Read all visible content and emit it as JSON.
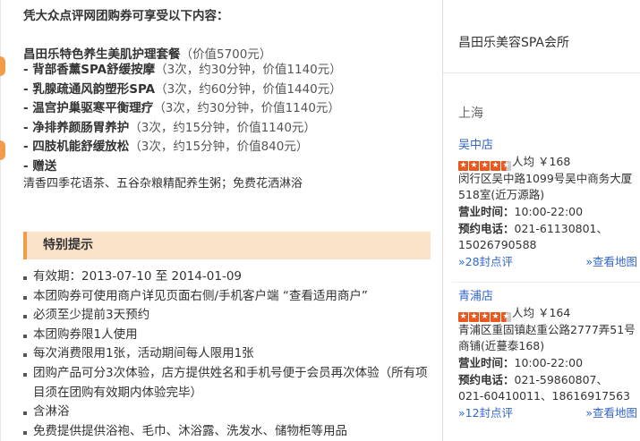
{
  "main": {
    "intro": "凭大众点评网团购券可享受以下内容：",
    "package": {
      "name": "昌田乐特色养生美肌护理套餐",
      "price": "（价值5700元）"
    },
    "items": [
      {
        "name": "- 背部香薰SPA舒缓按摩",
        "desc": "（3次，约30分钟，价值1140元）"
      },
      {
        "name": "- 乳腺疏通风韵塑形SPA",
        "desc": "（3次，约60分钟，价值1440元）"
      },
      {
        "name": "- 温宫护巢驱寒平衡理疗",
        "desc": "（3次，约30分钟，价值1140元）"
      },
      {
        "name": "- 净排养颜肠胃养护",
        "desc": "（3次，约15分钟，价值1140元）"
      },
      {
        "name": "- 四肢机能舒缓放松",
        "desc": "（3次，约15分钟，价值840元）"
      },
      {
        "name": "- 赠送",
        "desc": ""
      }
    ],
    "freebie": "清香四季花语茶、五谷杂粮精配养生粥；免费花洒淋浴",
    "notice_title": "特别提示",
    "tips": [
      "有效期：2013-07-10 至  2014-01-09",
      "本团购券可使用商户详见页面右侧/手机客户端 “查看适用商户”",
      "必须至少提前3天预约",
      "本团购券限1人使用",
      "每次消费限用1张，活动期间每人限用1张",
      "团购产品可分3次体验，店方提供姓名和手机号便于会员再次体验（所有项目须在团购有效期内体验完毕）",
      "含淋浴",
      "免费提供提供浴袍、毛巾、沐浴露、洗发水、储物柜等用品"
    ]
  },
  "sidebar": {
    "title": "昌田乐美容SPA会所",
    "city": "上海",
    "shops": [
      {
        "name": "吴中店",
        "rating": 4.5,
        "avg": "人均 ￥168",
        "address": "闵行区吴中路1099号吴中商务大厦518室(近万源路)",
        "hours_label": "营业时间：",
        "hours": "10:00-22:00",
        "phone_label": "预约电话：",
        "phone": "021-61130801、",
        "phone2": "15026790588",
        "reviews": "»28封点评",
        "map": "»查看地图"
      },
      {
        "name": "青浦店",
        "rating": 4.5,
        "avg": "人均 ￥164",
        "address": "青浦区重固镇赵重公路2777弄51号商铺(近蔓泰168)",
        "hours_label": "营业时间：",
        "hours": "10:00-22:00",
        "phone_label": "预约电话：",
        "phone": "021-59860807、",
        "phone2": "021-60410011、18616917563",
        "reviews": "»12封点评",
        "map": "»查看地图"
      }
    ]
  },
  "colors": {
    "accent": "#f29c4b",
    "notice_bg": "#fbe3c9",
    "link": "#3366cc",
    "star": "#e9581f"
  }
}
